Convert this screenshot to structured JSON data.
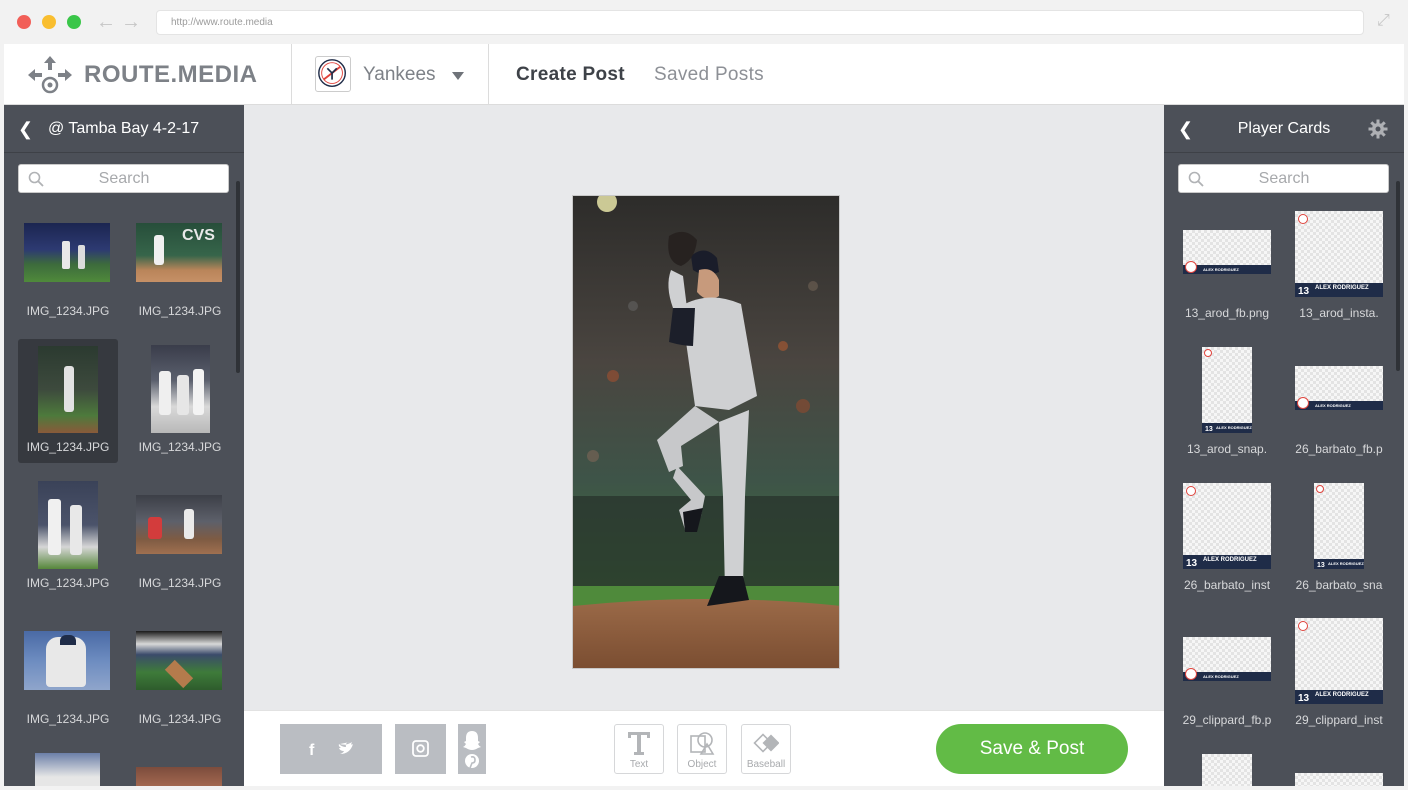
{
  "browser": {
    "url": "http://www.route.media"
  },
  "header": {
    "brand": "ROUTE.MEDIA",
    "team": "Yankees",
    "nav": [
      {
        "label": "Create Post",
        "active": true
      },
      {
        "label": "Saved Posts",
        "active": false
      }
    ]
  },
  "left_panel": {
    "title": "@ Tamba Bay 4-2-17",
    "search_placeholder": "Search",
    "thumbnails": [
      {
        "label": "IMG_1234.JPG",
        "selected": false
      },
      {
        "label": "IMG_1234.JPG",
        "selected": false
      },
      {
        "label": "IMG_1234.JPG",
        "selected": true
      },
      {
        "label": "IMG_1234.JPG",
        "selected": false
      },
      {
        "label": "IMG_1234.JPG",
        "selected": false
      },
      {
        "label": "IMG_1234.JPG",
        "selected": false
      },
      {
        "label": "IMG_1234.JPG",
        "selected": false
      },
      {
        "label": "IMG_1234.JPG",
        "selected": false
      }
    ]
  },
  "right_panel": {
    "title": "Player Cards",
    "search_placeholder": "Search",
    "cards": [
      {
        "label": "13_arod_fb.png",
        "number": "",
        "name": "ALEX RODRIGUEZ"
      },
      {
        "label": "13_arod_insta.",
        "number": "13",
        "name": "ALEX RODRIGUEZ"
      },
      {
        "label": "13_arod_snap.",
        "number": "13",
        "name": "ALEX RODRIGUEZ"
      },
      {
        "label": "26_barbato_fb.p",
        "number": "",
        "name": "ALEX RODRIGUEZ"
      },
      {
        "label": "26_barbato_inst",
        "number": "13",
        "name": "ALEX RODRIGUEZ"
      },
      {
        "label": "26_barbato_sna",
        "number": "13",
        "name": "ALEX RODRIGUEZ"
      },
      {
        "label": "29_clippard_fb.p",
        "number": "",
        "name": "ALEX RODRIGUEZ"
      },
      {
        "label": "29_clippard_inst",
        "number": "13",
        "name": "ALEX RODRIGUEZ"
      }
    ]
  },
  "toolbar": {
    "tools": [
      {
        "label": "Text",
        "icon": "text-icon"
      },
      {
        "label": "Object",
        "icon": "object-icon"
      },
      {
        "label": "Baseball",
        "icon": "baseball-icon"
      }
    ],
    "save_label": "Save & Post",
    "share_icons": [
      "facebook-icon",
      "twitter-icon",
      "instagram-icon",
      "snapchat-icon",
      "pinterest-icon"
    ]
  },
  "colors": {
    "panel": "#4c5058",
    "accent_green": "#62bb46",
    "canvas": "#e8e9eb"
  }
}
